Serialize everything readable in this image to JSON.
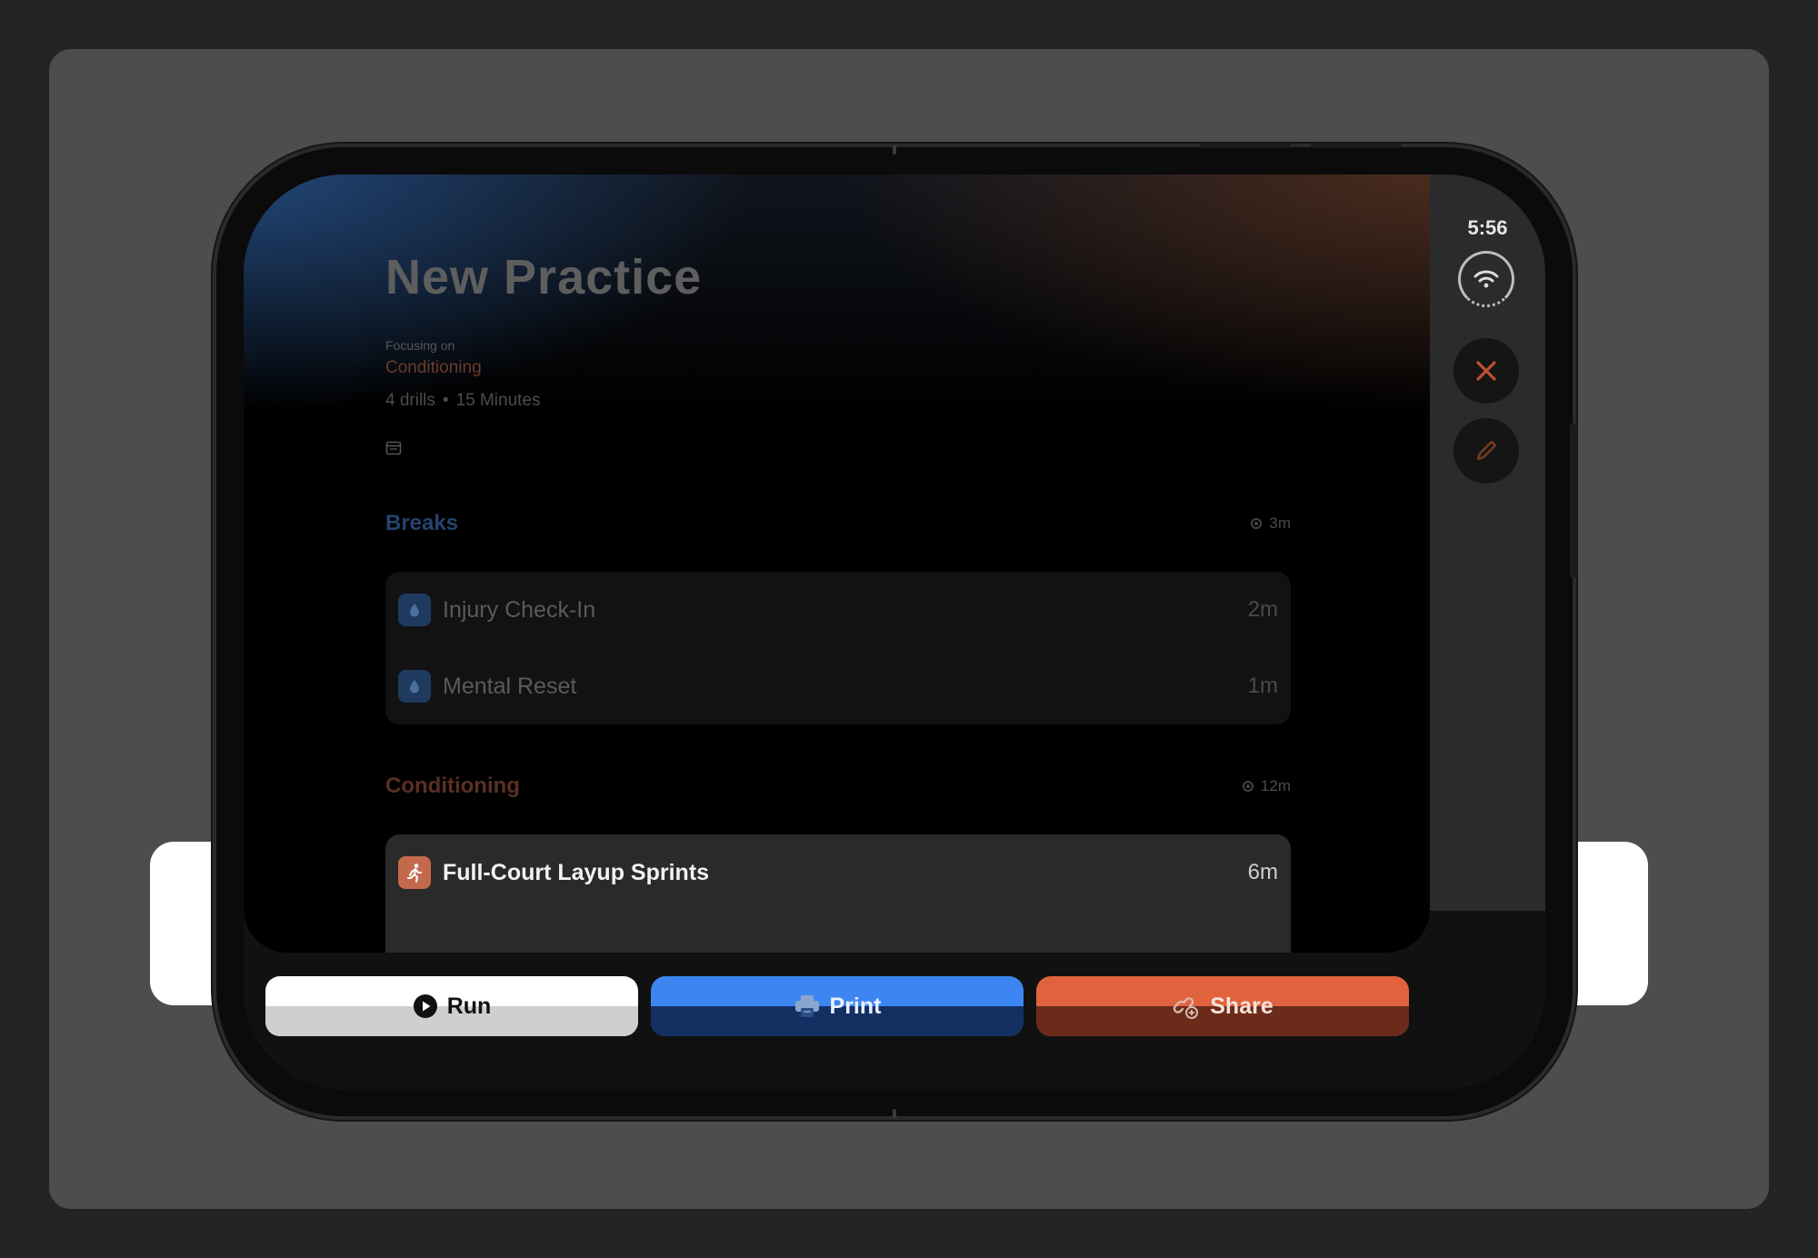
{
  "practice": {
    "title": "New Practice",
    "focus_label": "Focusing on",
    "focus_value": "Conditioning",
    "drill_count": "4 drills",
    "separator": "•",
    "duration": "15 Minutes"
  },
  "sections": [
    {
      "title": "Breaks",
      "duration": "3m",
      "color": "#24436e",
      "drills": [
        {
          "name": "Injury Check-In",
          "duration": "2m",
          "icon": "water-drop-icon"
        },
        {
          "name": "Mental Reset",
          "duration": "1m",
          "icon": "water-drop-icon"
        }
      ]
    },
    {
      "title": "Conditioning",
      "duration": "12m",
      "color": "#5a3022",
      "drills": [
        {
          "name": "Full-Court Layup Sprints",
          "duration": "6m",
          "icon": "running-figure-icon"
        }
      ]
    }
  ],
  "status": {
    "time": "5:56",
    "icon": "wifi-icon"
  },
  "actions": {
    "run": "Run",
    "print": "Print",
    "share": "Share"
  },
  "colors": {
    "run": "#ffffff",
    "print": "#3d86f2",
    "share": "#e1633d",
    "close_icon": "#c0512f",
    "edit_icon": "#7a3a22"
  }
}
